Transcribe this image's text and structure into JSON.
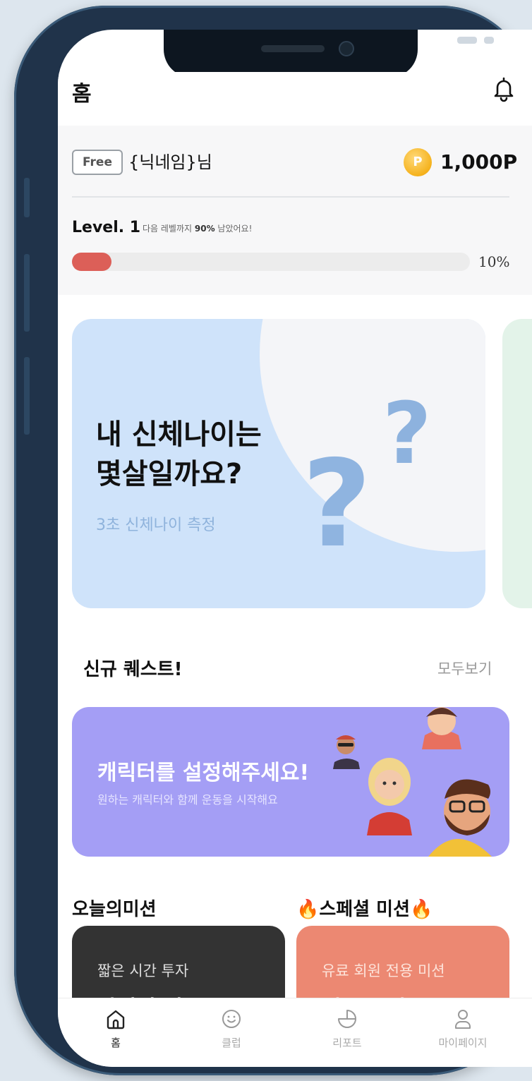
{
  "header": {
    "title": "홈"
  },
  "profile": {
    "membership": "Free",
    "nickname": "{닉네임}님",
    "coin_symbol": "P",
    "points": "1,000P",
    "level": "Level. 1",
    "level_message_prefix": "다음 레벨까지 ",
    "level_message_emphasis": "90%",
    "level_message_suffix": " 남았어요!",
    "progress_percent": 10,
    "progress_label": "10%"
  },
  "hero_banner": {
    "title_line1": "내 신체나이는",
    "title_line2": "몇살일까요?",
    "subtitle": "3초 신체나이 측정",
    "q_mark": "?"
  },
  "quests": {
    "section_title": "신규 퀘스트!",
    "see_all": "모두보기",
    "card": {
      "title": "캐릭터를 설정해주세요!",
      "subtitle": "원하는 캐릭터와 함께 운동을 시작해요"
    }
  },
  "missions": {
    "today_title": "오늘의미션",
    "special_title": "🔥스페셜 미션🔥",
    "today_card": {
      "subtitle": "짧은 시간 투자",
      "title": "자전거 전"
    },
    "special_card": {
      "subtitle": "유료 회원 전용 미션",
      "title": "월 구독하고"
    }
  },
  "tabbar": {
    "items": [
      {
        "label": "홈",
        "icon": "home-icon",
        "active": true
      },
      {
        "label": "클럽",
        "icon": "smile-icon",
        "active": false
      },
      {
        "label": "리포트",
        "icon": "pie-chart-icon",
        "active": false
      },
      {
        "label": "마이페이지",
        "icon": "person-icon",
        "active": false
      }
    ]
  },
  "colors": {
    "progress": "#dc5f58",
    "hero_bg": "#cfe3fa",
    "quest_bg": "#a49ef5",
    "mission_dark": "#333333",
    "mission_orange": "#ec8872"
  }
}
